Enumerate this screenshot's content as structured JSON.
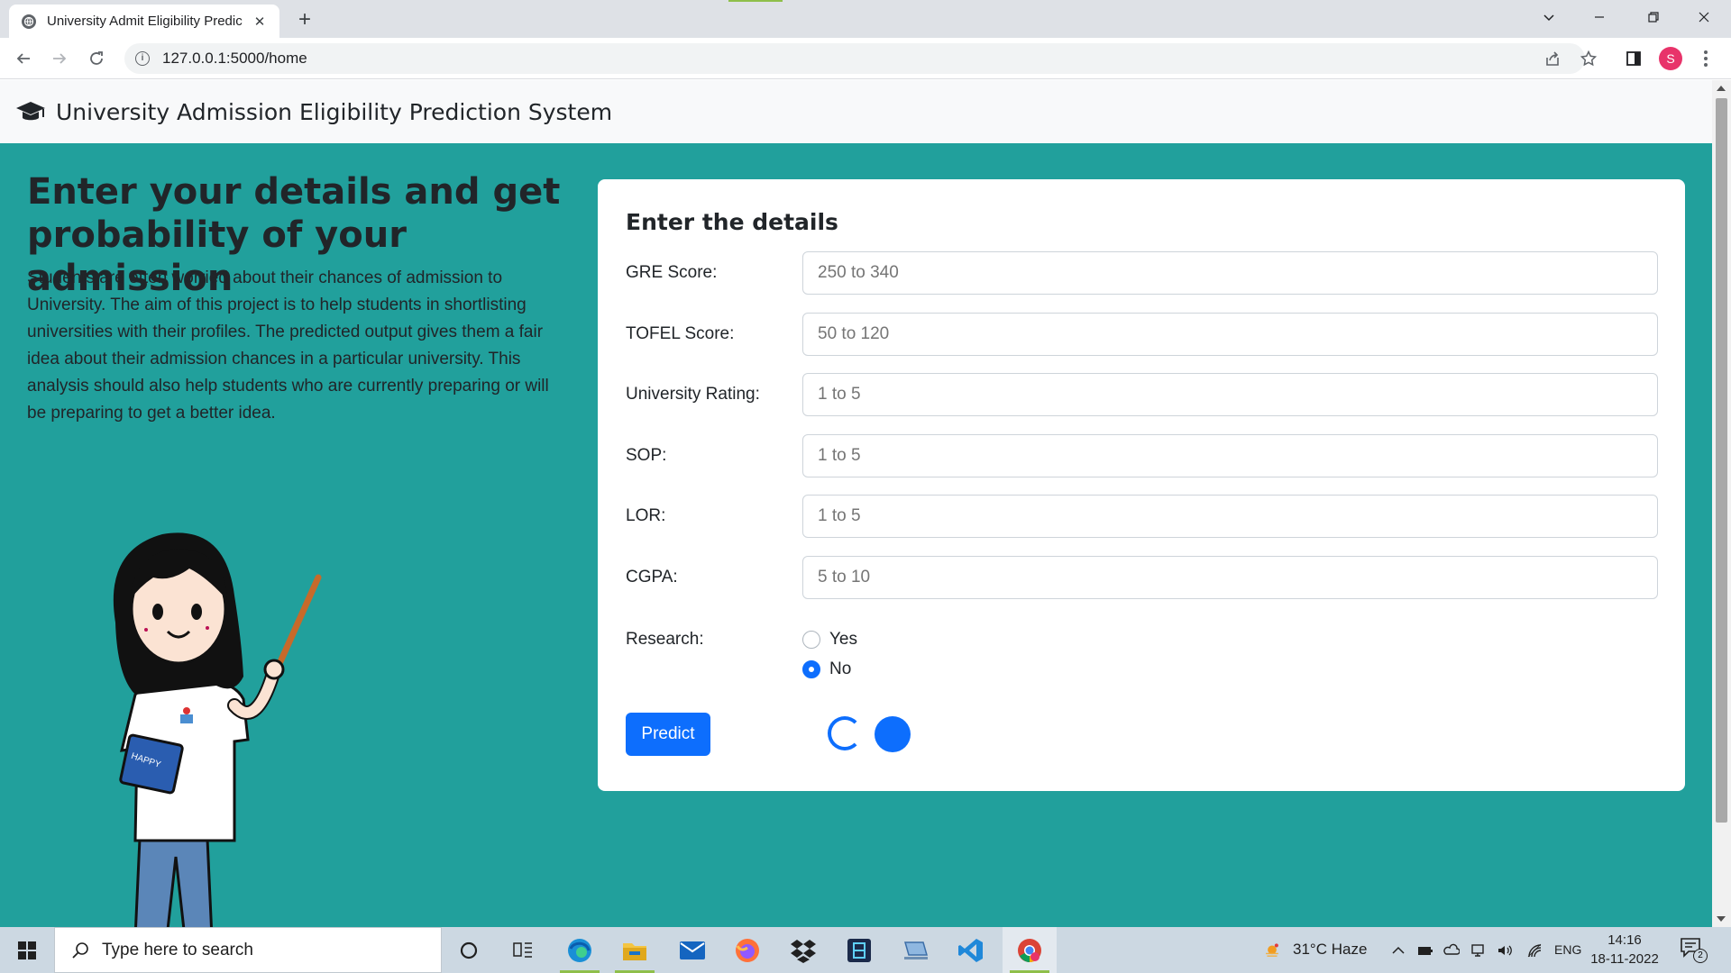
{
  "browser": {
    "tab_title": "University Admit Eligibility Predic",
    "url": "127.0.0.1:5000/home",
    "profile_initial": "S",
    "accent": "#8fbf4a"
  },
  "navbar": {
    "brand": "University Admission Eligibility Prediction System",
    "icon": "graduation-cap-icon"
  },
  "hero": {
    "title": "Enter your details and get probability of your admission",
    "description": "Students are often worried about their chances of admission to University. The aim of this project is to help students in shortlisting universities with their profiles. The predicted output gives them a fair idea about their admission chances in a particular university. This analysis should also help students who are currently preparing or will be preparing to get a better idea.",
    "illustration_text": "HAPPY"
  },
  "form": {
    "title": "Enter the details",
    "fields": [
      {
        "label": "GRE Score:",
        "placeholder": "250 to 340"
      },
      {
        "label": "TOFEL Score:",
        "placeholder": "50 to 120"
      },
      {
        "label": "University Rating:",
        "placeholder": "1 to 5"
      },
      {
        "label": "SOP:",
        "placeholder": "1 to 5"
      },
      {
        "label": "LOR:",
        "placeholder": "1 to 5"
      },
      {
        "label": "CGPA:",
        "placeholder": "5 to 10"
      }
    ],
    "research": {
      "label": "Research:",
      "options": [
        "Yes",
        "No"
      ],
      "selected": "No"
    },
    "predict_label": "Predict",
    "primary_color": "#0d6efd"
  },
  "page_background": "#21a09c",
  "taskbar": {
    "search_placeholder": "Type here to search",
    "weather": "31°C  Haze",
    "language": "ENG",
    "time": "14:16",
    "date": "18-11-2022",
    "notification_count": "2"
  }
}
